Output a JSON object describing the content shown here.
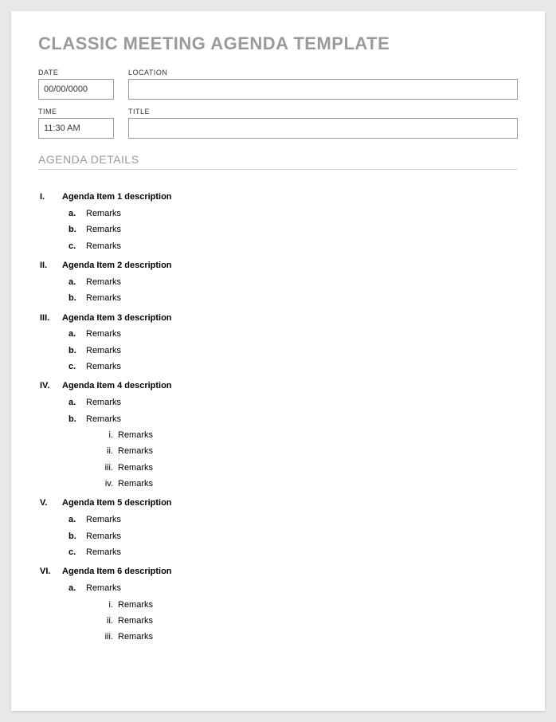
{
  "title": "CLASSIC MEETING AGENDA TEMPLATE",
  "fields": {
    "date": {
      "label": "DATE",
      "value": "00/00/0000"
    },
    "location": {
      "label": "LOCATION",
      "value": ""
    },
    "time": {
      "label": "TIME",
      "value": "11:30 AM"
    },
    "title": {
      "label": "TITLE",
      "value": ""
    }
  },
  "section_heading": "AGENDA DETAILS",
  "agenda": [
    {
      "num": "I.",
      "label": "Agenda Item 1 description",
      "remarks": [
        {
          "num": "a.",
          "label": "Remarks"
        },
        {
          "num": "b.",
          "label": "Remarks"
        },
        {
          "num": "c.",
          "label": "Remarks"
        }
      ]
    },
    {
      "num": "II.",
      "label": "Agenda Item 2 description",
      "remarks": [
        {
          "num": "a.",
          "label": "Remarks"
        },
        {
          "num": "b.",
          "label": "Remarks"
        }
      ]
    },
    {
      "num": "III.",
      "label": "Agenda Item 3 description",
      "remarks": [
        {
          "num": "a.",
          "label": "Remarks"
        },
        {
          "num": "b.",
          "label": "Remarks"
        },
        {
          "num": "c.",
          "label": "Remarks"
        }
      ]
    },
    {
      "num": "IV.",
      "label": "Agenda Item 4 description",
      "remarks": [
        {
          "num": "a.",
          "label": "Remarks"
        },
        {
          "num": "b.",
          "label": "Remarks",
          "sub": [
            {
              "num": "i.",
              "label": "Remarks"
            },
            {
              "num": "ii.",
              "label": "Remarks"
            },
            {
              "num": "iii.",
              "label": "Remarks"
            },
            {
              "num": "iv.",
              "label": "Remarks"
            }
          ]
        }
      ]
    },
    {
      "num": "V.",
      "label": "Agenda Item 5 description",
      "remarks": [
        {
          "num": "a.",
          "label": "Remarks"
        },
        {
          "num": "b.",
          "label": "Remarks"
        },
        {
          "num": "c.",
          "label": "Remarks"
        }
      ]
    },
    {
      "num": "VI.",
      "label": "Agenda Item 6 description",
      "remarks": [
        {
          "num": "a.",
          "label": "Remarks",
          "sub": [
            {
              "num": "i.",
              "label": "Remarks"
            },
            {
              "num": "ii.",
              "label": "Remarks"
            },
            {
              "num": "iii.",
              "label": "Remarks"
            }
          ]
        }
      ]
    }
  ]
}
